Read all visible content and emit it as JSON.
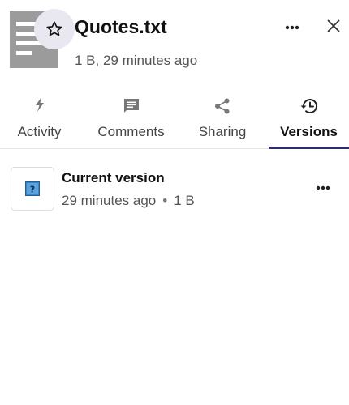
{
  "file": {
    "name": "Quotes.txt",
    "meta": "1 B, 29 minutes ago",
    "icon": "text-file-icon",
    "favorite_icon": "star-outline-icon"
  },
  "header_actions": {
    "more_icon": "ellipsis-icon",
    "close_icon": "close-icon"
  },
  "tabs": [
    {
      "label": "Activity",
      "icon": "lightning-icon",
      "active": false
    },
    {
      "label": "Comments",
      "icon": "comment-icon",
      "active": false
    },
    {
      "label": "Sharing",
      "icon": "share-icon",
      "active": false
    },
    {
      "label": "Versions",
      "icon": "history-icon",
      "active": true
    }
  ],
  "versions": [
    {
      "title": "Current version",
      "time": "29 minutes ago",
      "size": "1 B",
      "icon": "unknown-file-icon",
      "more_icon": "ellipsis-icon"
    }
  ],
  "colors": {
    "accent": "#2d2a6e",
    "favorite_bg": "#e9e7f0",
    "thumb_gray": "#9b9b9b"
  }
}
